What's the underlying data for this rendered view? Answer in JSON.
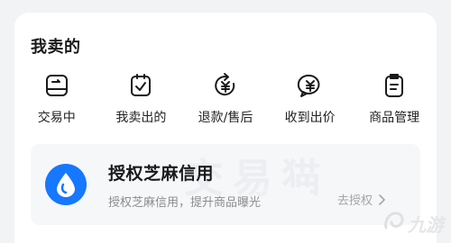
{
  "section": {
    "title": "我卖的"
  },
  "shortcuts": [
    {
      "label": "交易中",
      "icon": "trading-icon"
    },
    {
      "label": "我卖出的",
      "icon": "sold-icon"
    },
    {
      "label": "退款/售后",
      "icon": "refund-icon"
    },
    {
      "label": "收到出价",
      "icon": "offer-icon"
    },
    {
      "label": "商品管理",
      "icon": "product-manage-icon"
    }
  ],
  "banner": {
    "title": "授权芝麻信用",
    "description": "授权芝麻信用，提升商品曝光",
    "action_label": "去授权",
    "watermark": "交易猫",
    "logo_icon": "sesame-credit-icon"
  },
  "site_logo": {
    "text": "九游",
    "icon": "ninegame-logo-icon"
  },
  "colors": {
    "brand_blue": "#1677ff",
    "icon_stroke": "#1a1a1a",
    "card_bg": "#ffffff",
    "banner_bg": "#f6f7f9"
  }
}
